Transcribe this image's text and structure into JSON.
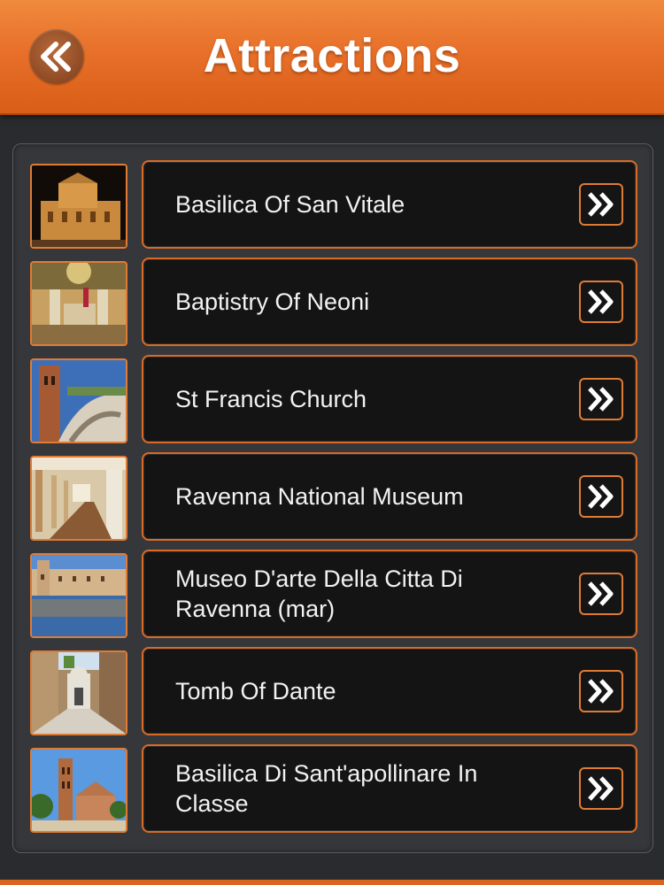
{
  "header": {
    "title": "Attractions",
    "back_icon": "double-chevron-left-icon",
    "color": "#e8702a"
  },
  "accent_color": "#e07b36",
  "items": [
    {
      "label": "Basilica Of San Vitale",
      "thumb": "basilica-san-vitale-photo"
    },
    {
      "label": "Baptistry Of Neoni",
      "thumb": "baptistry-neoni-photo"
    },
    {
      "label": "St Francis Church",
      "thumb": "st-francis-church-photo"
    },
    {
      "label": "Ravenna National Museum",
      "thumb": "national-museum-photo"
    },
    {
      "label": "Museo D'arte Della Citta Di Ravenna (mar)",
      "thumb": "museo-darte-photo"
    },
    {
      "label": "Tomb Of Dante",
      "thumb": "tomb-of-dante-photo"
    },
    {
      "label": "Basilica Di Sant'apollinare In Classe",
      "thumb": "sant-apollinare-photo"
    }
  ]
}
